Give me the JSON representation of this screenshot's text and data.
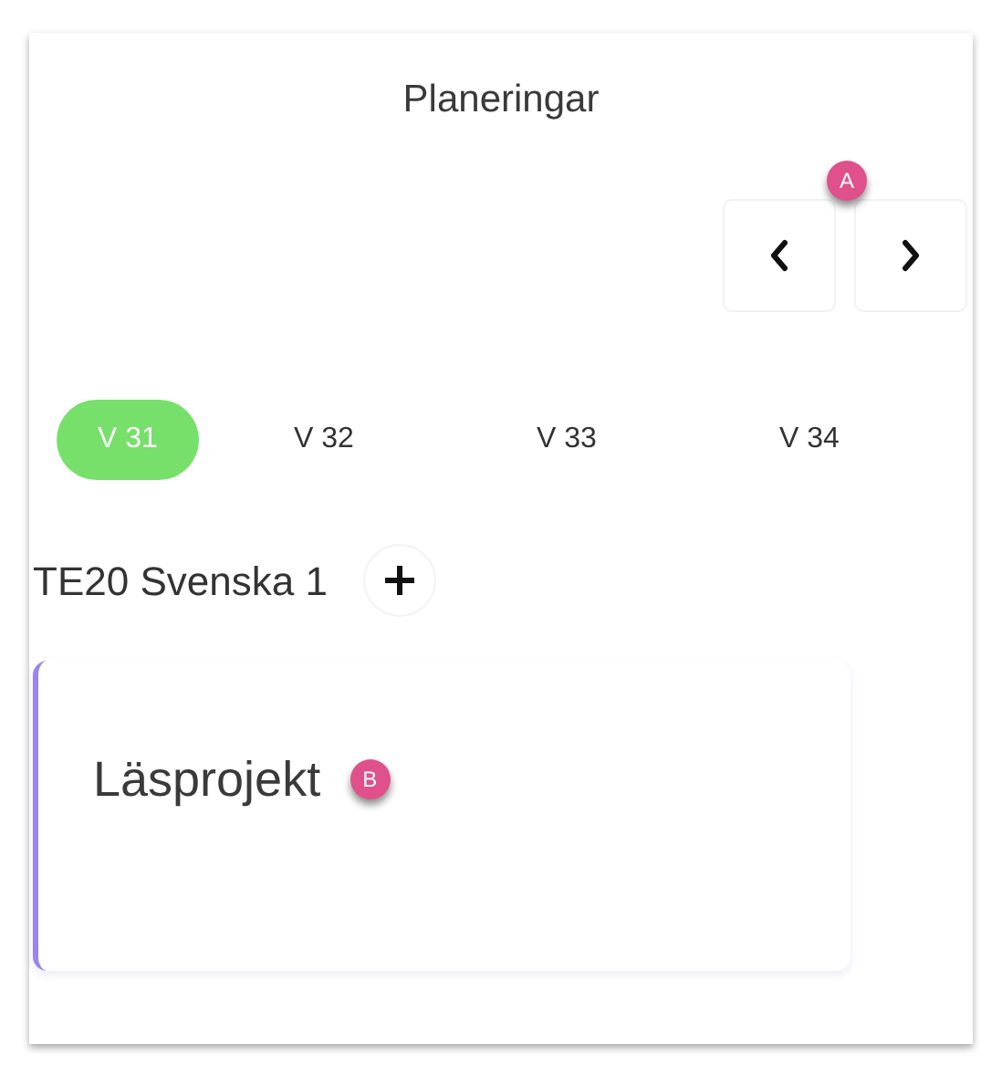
{
  "title": "Planeringar",
  "pager": {
    "marker": "A"
  },
  "weeks": [
    {
      "label": "V 31",
      "selected": true
    },
    {
      "label": "V 32",
      "selected": false
    },
    {
      "label": "V 33",
      "selected": false
    },
    {
      "label": "V 34",
      "selected": false
    }
  ],
  "course": {
    "name": "TE20 Svenska 1"
  },
  "cards": [
    {
      "title": "Läsprojekt",
      "marker": "B"
    }
  ]
}
